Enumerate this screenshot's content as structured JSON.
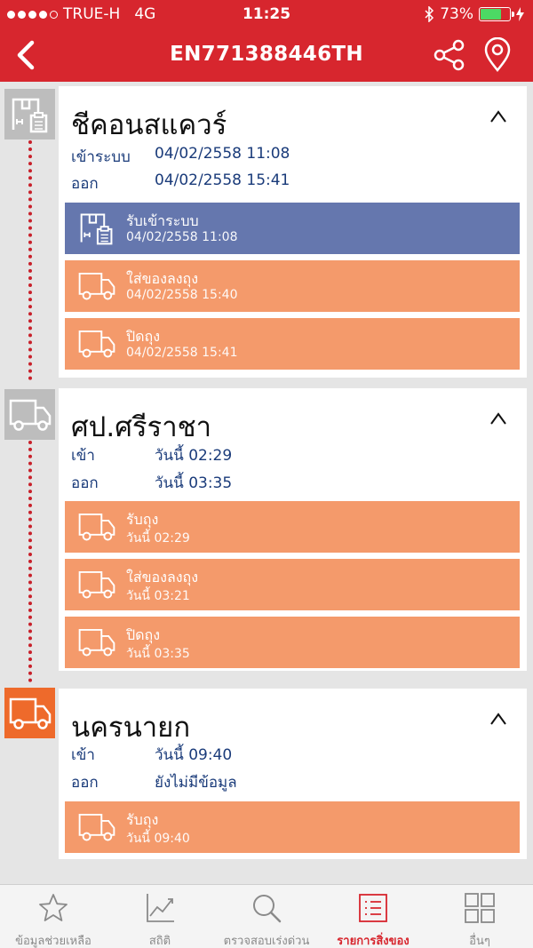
{
  "status_bar": {
    "carrier": "TRUE-H",
    "network": "4G",
    "time": "11:25",
    "battery": "73%",
    "battery_level": 0.73
  },
  "header": {
    "title": "EN771388446TH",
    "back_icon": "back-chevron-icon",
    "share_icon": "share-icon",
    "location_icon": "location-pin-icon"
  },
  "locations": [
    {
      "name": "ชีคอนสแควร์",
      "rows": [
        {
          "label": "เข้าระบบ",
          "value": "04/02/2558 11:08"
        },
        {
          "label": "ออก",
          "value": "04/02/2558 15:41"
        }
      ],
      "events": [
        {
          "title": "รับเข้าระบบ",
          "date": "04/02/2558 11:08",
          "color": "#6577ae",
          "icon": "parcel-accept-icon"
        },
        {
          "title": "ใส่ของลงถุง",
          "date": "04/02/2558 15:40",
          "color": "#f49a6b",
          "icon": "truck-icon"
        },
        {
          "title": "ปิดถุง",
          "date": "04/02/2558 15:41",
          "color": "#f49a6b",
          "icon": "truck-icon"
        }
      ]
    },
    {
      "name": "ศป.ศรีราชา",
      "rows": [
        {
          "label": "เข้า",
          "value": "วันนี้ 02:29"
        },
        {
          "label": "ออก",
          "value": "วันนี้ 03:35"
        }
      ],
      "events": [
        {
          "title": "รับถุง",
          "date": "วันนี้ 02:29",
          "color": "#f49a6b",
          "icon": "truck-icon"
        },
        {
          "title": "ใส่ของลงถุง",
          "date": "วันนี้ 03:21",
          "color": "#f49a6b",
          "icon": "truck-icon"
        },
        {
          "title": "ปิดถุง",
          "date": "วันนี้ 03:35",
          "color": "#f49a6b",
          "icon": "truck-icon"
        }
      ]
    },
    {
      "name": "นครนายก",
      "rows": [
        {
          "label": "เข้า",
          "value": "วันนี้ 09:40"
        },
        {
          "label": "ออก",
          "value": "ยังไม่มีข้อมูล"
        }
      ],
      "events": [
        {
          "title": "รับถุง",
          "date": "วันนี้ 09:40",
          "color": "#f49a6b",
          "icon": "truck-icon"
        }
      ]
    }
  ],
  "tabs": [
    {
      "label": "ข้อมูลช่วยเหลือ",
      "icon": "star-icon",
      "active": false
    },
    {
      "label": "สถิติ",
      "icon": "chart-icon",
      "active": false
    },
    {
      "label": "ตรวจสอบเร่งด่วน",
      "icon": "search-icon",
      "active": false
    },
    {
      "label": "รายการสิ่งของ",
      "icon": "list-icon",
      "active": true
    },
    {
      "label": "อื่นๆ",
      "icon": "grid-icon",
      "active": false
    }
  ],
  "colors": {
    "brand_red": "#d7262e",
    "event_blue": "#6577ae",
    "event_orange": "#f49a6b",
    "timeline_orange": "#ee6a2b"
  }
}
